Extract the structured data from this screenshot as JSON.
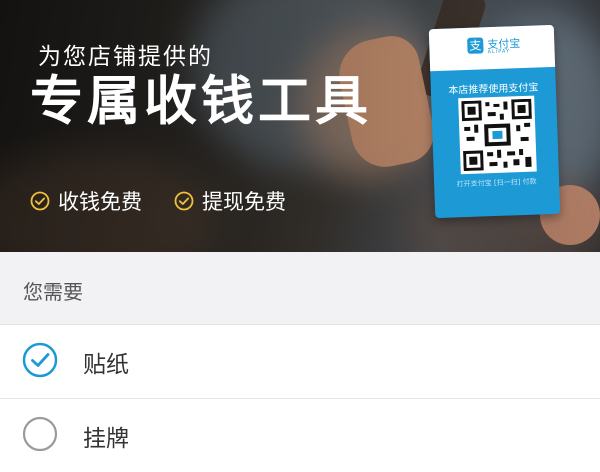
{
  "banner": {
    "subtitle": "为您店铺提供的",
    "title": "专属收钱工具",
    "features": [
      "收钱免费",
      "提现免费"
    ],
    "card": {
      "logo_text": "支付宝",
      "logo_sub": "ALIPAY",
      "top_text": "本店推荐使用支付宝",
      "bottom_text": "打开支付宝 [扫一扫] 付款"
    }
  },
  "form": {
    "section_title": "您需要",
    "options": [
      {
        "label": "贴纸",
        "selected": true
      },
      {
        "label": "挂牌",
        "selected": false
      }
    ]
  },
  "colors": {
    "accent": "#1d9ad6",
    "feature_check": "#f0c23c",
    "radio_border": "#9a9a9a"
  }
}
